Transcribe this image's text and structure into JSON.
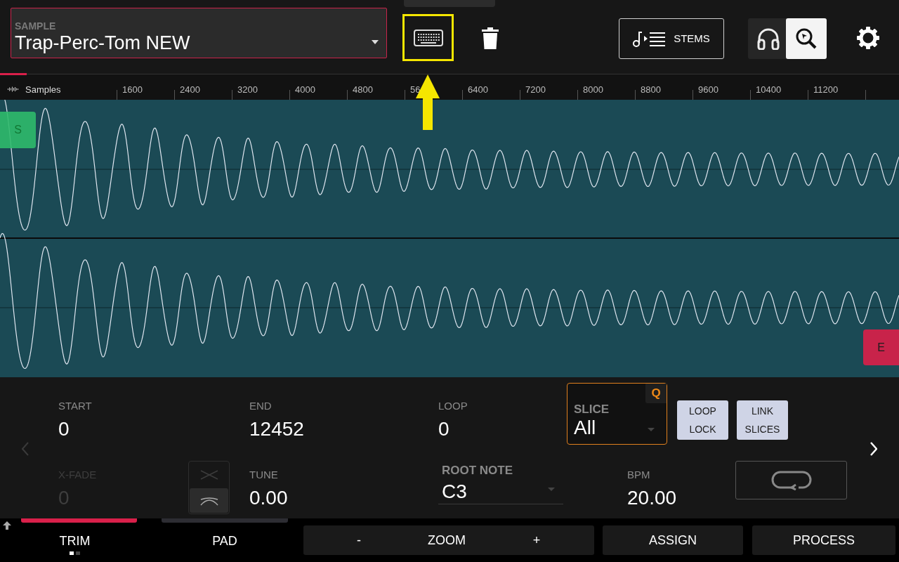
{
  "sample": {
    "label": "SAMPLE",
    "value": "Trap-Perc-Tom NEW"
  },
  "stems": {
    "label": "STEMS"
  },
  "view_buttons": [
    {
      "kind": "headphones",
      "selected": false
    },
    {
      "kind": "cursor-zoom",
      "selected": true
    }
  ],
  "ruler": {
    "label": "Samples",
    "ticks": [
      "1600",
      "2400",
      "3200",
      "4000",
      "4800",
      "56",
      "6400",
      "7200",
      "8000",
      "8800",
      "9600",
      "10400",
      "11200"
    ]
  },
  "markers": [
    {
      "kind": "start",
      "label": "S"
    },
    {
      "kind": "end",
      "label": "E"
    }
  ],
  "row_1": [
    {
      "kind": "value",
      "label": "START",
      "value": "0",
      "disabled": false
    },
    {
      "kind": "value",
      "label": "END",
      "value": "12452",
      "disabled": false
    },
    {
      "kind": "value",
      "label": "LOOP",
      "value": "0",
      "disabled": false
    },
    {
      "kind": "slice",
      "label": "SLICE",
      "value": "All",
      "badge": "Q"
    },
    {
      "kind": "button",
      "lines": [
        "LOOP",
        "LOCK"
      ]
    },
    {
      "kind": "button",
      "lines": [
        "LINK",
        "SLICES"
      ]
    }
  ],
  "row_2": [
    {
      "kind": "value",
      "label": "X-FADE",
      "value": "0",
      "disabled": true
    },
    {
      "kind": "xfade-toggle",
      "options": [
        {
          "selected": false
        },
        {
          "selected": true
        }
      ]
    },
    {
      "kind": "value",
      "label": "TUNE",
      "value": "0.00",
      "disabled": false
    },
    {
      "kind": "dropdown",
      "label": "ROOT NOTE",
      "value": "C3"
    },
    {
      "kind": "value",
      "label": "BPM",
      "value": "20.00",
      "disabled": false
    },
    {
      "kind": "loop-button"
    }
  ],
  "nav": {
    "previous_disabled": true,
    "next_disabled": false
  },
  "tabs": [
    {
      "label": "TRIM",
      "selected": true
    },
    {
      "label": "PAD",
      "selected": false
    }
  ],
  "page_dots": [
    {
      "selected": true
    },
    {
      "selected": false
    }
  ],
  "zoom": {
    "minus": "-",
    "label": "ZOOM",
    "plus": "+"
  },
  "actions": [
    "ASSIGN",
    "PROCESS"
  ]
}
